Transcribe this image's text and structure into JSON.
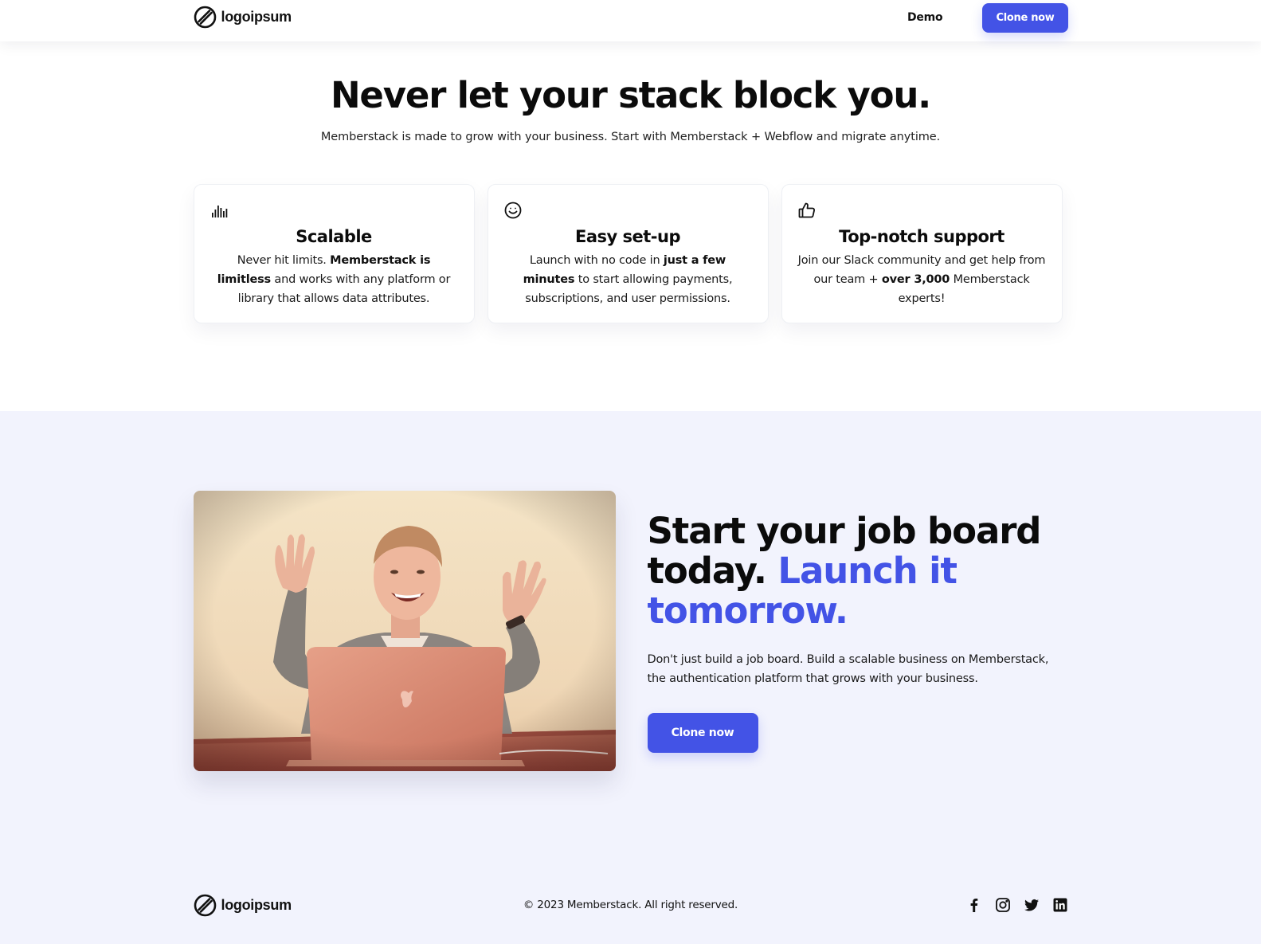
{
  "header": {
    "logo_text": "logoipsum",
    "nav_demo": "Demo",
    "clone_button": "Clone now"
  },
  "hero": {
    "title": "Never let your stack block you.",
    "subtitle": "Memberstack is made to grow with your business. Start with Memberstack + Webflow and migrate anytime."
  },
  "features": [
    {
      "icon": "bar-chart-icon",
      "title": "Scalable",
      "text_before": "Never hit limits. ",
      "text_bold": "Memberstack is limitless",
      "text_after": " and works with any platform or library that allows data attributes."
    },
    {
      "icon": "smile-icon",
      "title": "Easy set-up",
      "text_before": "Launch with no code in ",
      "text_bold": "just a few minutes",
      "text_after": " to start allowing payments, subscriptions, and user permissions."
    },
    {
      "icon": "thumbs-up-icon",
      "title": "Top-notch support",
      "text_before": "Join our Slack community and get help from our team + ",
      "text_bold": "over 3,000",
      "text_after": " Memberstack experts!"
    }
  ],
  "jobs": {
    "title_part1": "Start your job board today. ",
    "title_accent": "Launch it tomorrow.",
    "description": "Don't just build a job board. Build a scalable business on Memberstack, the authentication platform that grows with your business.",
    "cta_label": "Clone now",
    "photo_icon": "person-waving-with-laptop-photo"
  },
  "footer": {
    "logo_text": "logoipsum",
    "copyright": "© 2023 Memberstack. All right reserved.",
    "socials": [
      "facebook-icon",
      "instagram-icon",
      "twitter-icon",
      "linkedin-icon"
    ]
  },
  "colors": {
    "accent": "#4353e6",
    "section_bg": "#f2f3fd",
    "text": "#0b0b0b"
  }
}
